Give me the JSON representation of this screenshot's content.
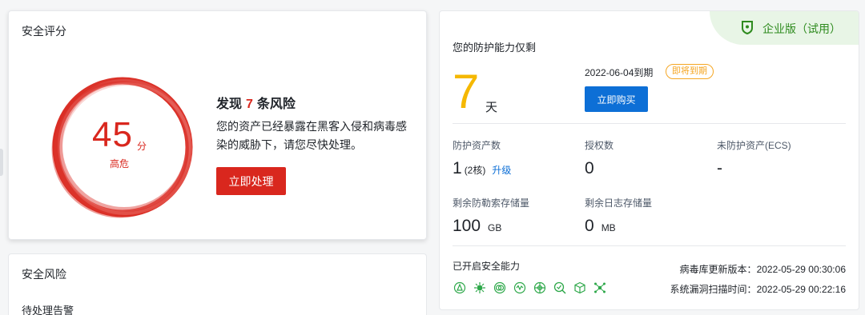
{
  "score_card": {
    "title": "安全评分",
    "score": "45",
    "score_unit": "分",
    "level": "高危",
    "risk_prefix": "发现",
    "risk_count": "7",
    "risk_suffix": "条风险",
    "description": "您的资产已经暴露在黑客入侵和病毒感染的威胁下，请您尽快处理。",
    "action_label": "立即处理"
  },
  "risk_card": {
    "title": "安全风险",
    "sub_label": "待处理告警"
  },
  "protection": {
    "edition": "企业版（试用）",
    "remain_label": "您的防护能力仅剩",
    "days": "7",
    "days_unit": "天",
    "expire_date": "2022-06-04到期",
    "expire_badge": "即将到期",
    "buy_label": "立即购买",
    "stats": {
      "protected_assets_label": "防护资产数",
      "protected_assets_value": "1",
      "protected_assets_cores": "(2核)",
      "upgrade_label": "升级",
      "licenses_label": "授权数",
      "licenses_value": "0",
      "unprotected_label": "未防护资产(ECS)",
      "unprotected_value": "-",
      "ransom_storage_label": "剩余防勒索存储量",
      "ransom_storage_value": "100",
      "ransom_storage_unit": "GB",
      "log_storage_label": "剩余日志存储量",
      "log_storage_value": "0",
      "log_storage_unit": "MB"
    },
    "capabilities_label": "已开启安全能力",
    "capability_icons": [
      "alert-triangle-icon",
      "virus-icon",
      "shield-ring-icon",
      "wave-icon",
      "crosshair-icon",
      "scan-magnify-icon",
      "cube-icon",
      "network-icon"
    ],
    "virus_db_label": "病毒库更新版本：",
    "virus_db_time": "2022-05-29 00:30:06",
    "vuln_scan_label": "系统漏洞扫描时间：",
    "vuln_scan_time": "2022-05-29 00:22:16"
  },
  "colors": {
    "danger": "#d9271e",
    "warning": "#f5b800",
    "primary": "#0d6fd6",
    "success": "#2e8b1e"
  }
}
